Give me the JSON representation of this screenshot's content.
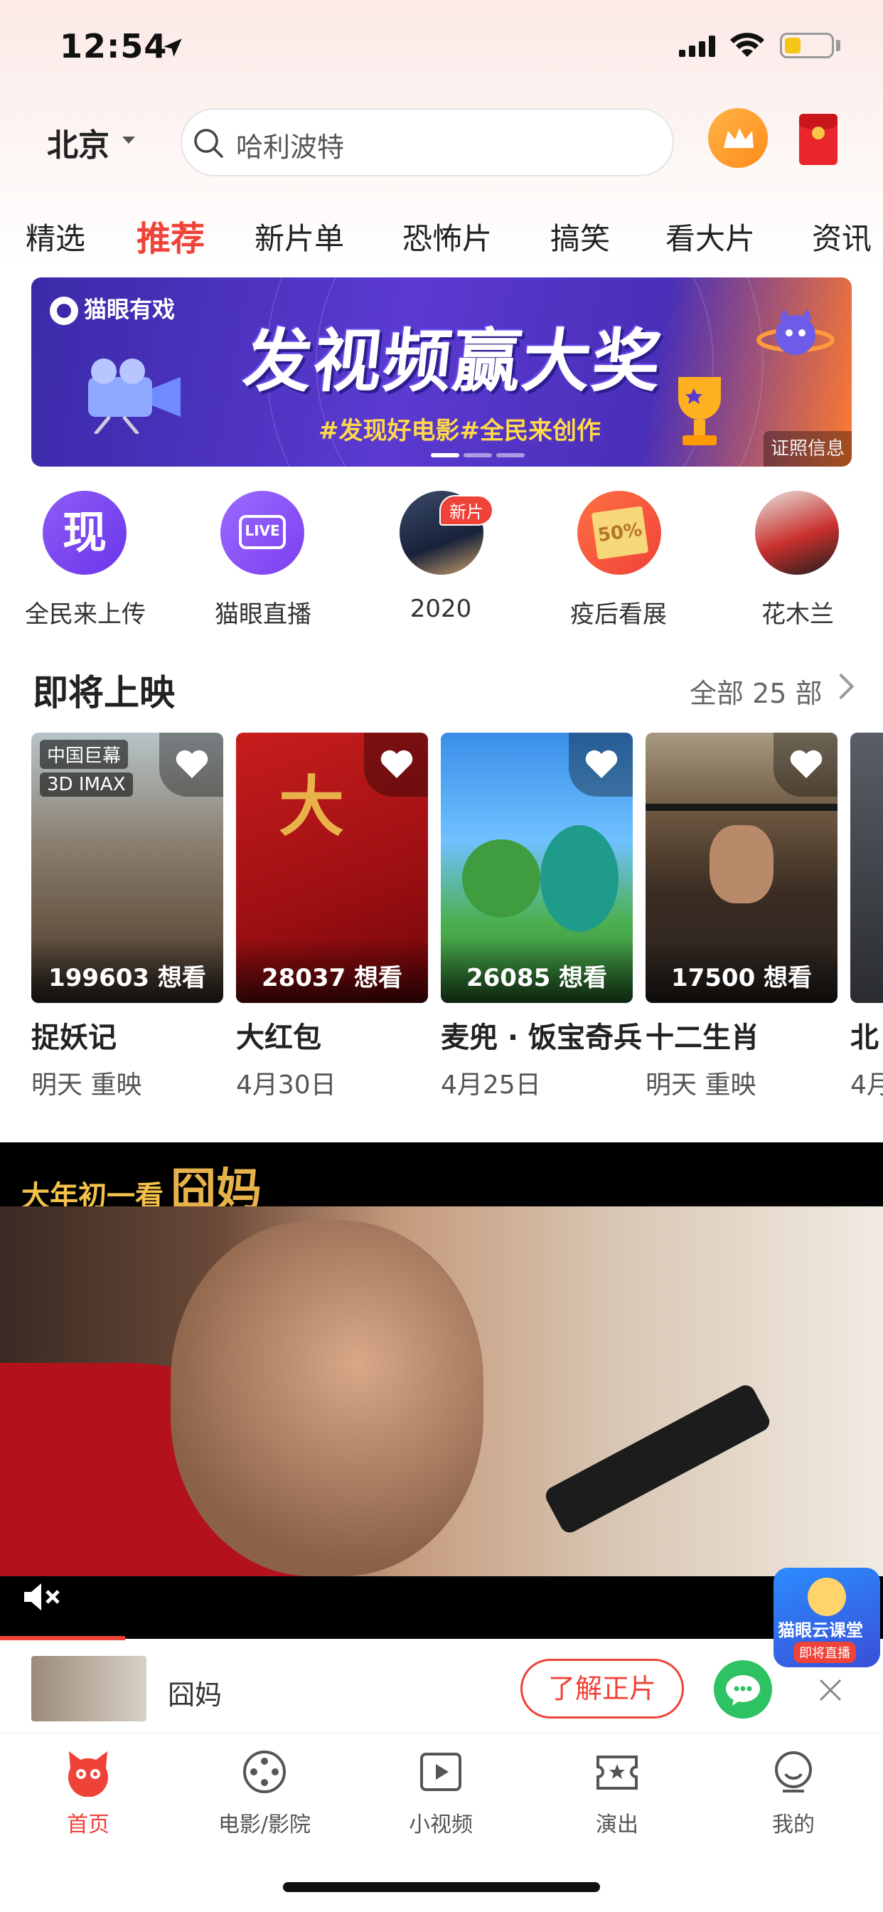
{
  "status_bar": {
    "time": "12:54"
  },
  "header": {
    "city": "北京",
    "search_placeholder": "哈利波特"
  },
  "tabs": [
    "精选",
    "推荐",
    "新片单",
    "恐怖片",
    "搞笑",
    "看大片",
    "资讯"
  ],
  "active_tab": "推荐",
  "banner": {
    "brand": "猫眼有戏",
    "title": "发视频赢大奖",
    "subtitle": "#发现好电影#全民来创作",
    "license": "证照信息"
  },
  "quick_entries": [
    {
      "label": "全民来上传",
      "icon": "现"
    },
    {
      "label": "猫眼直播",
      "icon": "LIVE"
    },
    {
      "label": "2020",
      "badge": "新片"
    },
    {
      "label": "疫后看展",
      "icon": "50%"
    },
    {
      "label": "花木兰"
    }
  ],
  "upcoming": {
    "title": "即将上映",
    "more": "全部 25 部",
    "movies": [
      {
        "title": "捉妖记",
        "date": "明天 重映",
        "want": "199603 想看",
        "tags": [
          "中国巨幕",
          "3D IMAX"
        ]
      },
      {
        "title": "大红包",
        "date": "4月30日",
        "want": "28037 想看"
      },
      {
        "title": "麦兜 · 饭宝奇兵",
        "date": "4月25日",
        "want": "26085 想看"
      },
      {
        "title": "十二生肖",
        "date": "明天 重映",
        "want": "17500 想看"
      },
      {
        "title": "北",
        "date": "4月"
      }
    ]
  },
  "video": {
    "caption_small": "大年初一看",
    "caption_big": "囧妈",
    "badge_title": "猫眼云课堂",
    "badge_sub": "即将直播",
    "info_title": "囧妈",
    "cta": "了解正片"
  },
  "bottom_nav": [
    {
      "label": "首页",
      "icon": "cat-icon"
    },
    {
      "label": "电影/影院",
      "icon": "film-reel-icon"
    },
    {
      "label": "小视频",
      "icon": "play-icon"
    },
    {
      "label": "演出",
      "icon": "ticket-star-icon"
    },
    {
      "label": "我的",
      "icon": "profile-icon"
    }
  ],
  "colors": {
    "accent": "#ef4238"
  }
}
